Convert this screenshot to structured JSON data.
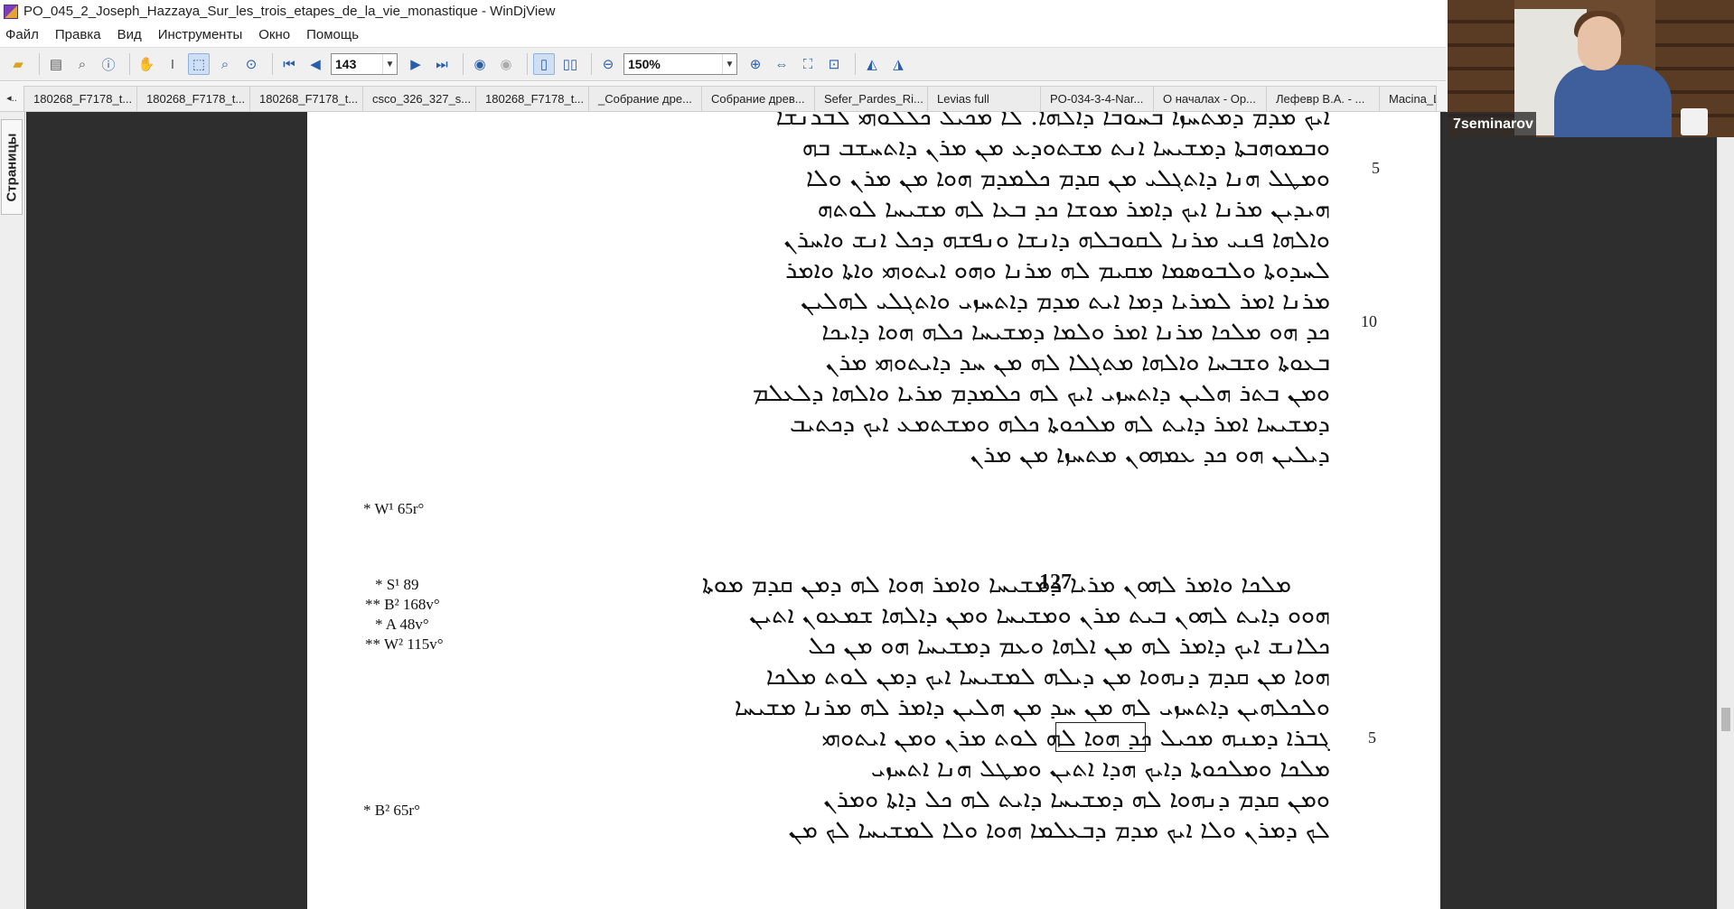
{
  "window": {
    "title": "PO_045_2_Joseph_Hazzaya_Sur_les_trois_etapes_de_la_vie_monastique - WinDjView"
  },
  "menu": [
    "Файл",
    "Правка",
    "Вид",
    "Инструменты",
    "Окно",
    "Помощь"
  ],
  "toolbar": {
    "page_number": "143",
    "zoom": "150%"
  },
  "tabs": [
    "180268_F7178_t...",
    "180268_F7178_t...",
    "180268_F7178_t...",
    "csco_326_327_s...",
    "180268_F7178_t...",
    "_Собрание дре...",
    "Собрание древ...",
    "Sefer_Pardes_Ri...",
    "Levias full",
    "PO-034-3-4-Nar...",
    "О началах - Ор...",
    "Лефевр В.А. - ...",
    "Macina_Le"
  ],
  "side_panel": {
    "pages_tab": "Страницы"
  },
  "document": {
    "lines": [
      "ܐܝܟ ܡܕܡ ܕܡܬܚܙܐ ܒܚܘܒܐ ܕܐܠܗܐ. ܠܐ ܡܟܝܠ ܟܠܠܘܗܝ ܠܒܪܢܫܐ",
      "ܘܒܡܘܗܒܬܐ ܕܡܫܝܚܐ ܐܢܬ ܡܫܬܘܕܥ ܡܢ ܡܪܢ ܕܐܬܚܫܒ ܒܗ",
      "ܘܡܛܠ ܗܢܐ ܕܐܬܓܠܝ ܡܢ ܩܕܡ ܟܠܡܕܡ ܗܘܐ ܡܢ ܡܪܢ ܘܠܐ",
      "ܗܝܕܝܢ ܡܪܢܐ ܐܝܟ ܕܐܡܪ ܡܘܫܐ ܟܕ ܒܥܐ ܠܗ ܡܫܝܚܐ ܠܘܬܗ",
      "ܘܐܠܗܐ ܦܢܝ ܡܪܢܐ ܠܩܘܒܠܗ ܕܐܢܫܐ ܘܢܦܫܗ ܕܟܠ ܐܢܫ ܘܐܚܪܢ",
      "ܠܚܕܘܬܐ ܘܠܒܘܣܡܐ ܡܩܝܡ ܠܗ ܡܪܢܐ ܘܗܘ ܐܝܬܘܗܝ ܘܐܬܐ ܘܐܡܪ",
      "ܡܪܢܐ ܐܡܪ ܠܡܪܝܐ ܕܡܐ ܐܝܬ ܡܕܡ ܕܐܬܚܙܝ ܘܐܬܓܠܝ ܠܗܠܝܢ",
      "ܟܕ ܗܘ ܡܠܟܐ ܡܪܢܐ ܐܡܪ ܘܠܡܐ ܕܡܫܝܚܐ ܟܠܗ ܗܘܐ ܕܐܝܟܐ",
      "ܒܥܘܬܐ ܘܫܒܚܐ ܘܐܠܗܐ ܡܬܓܠܐ ܠܗ ܡܢ ܚܕ ܕܐܝܬܘܗܝ ܡܪܢ",
      "ܘܡܢ ܒܬܪ ܗܠܝܢ ܕܐܬܚܙܝ ܐܝܟ ܠܗ ܟܠܡܕܡ ܡܪܝܐ ܘܐܠܗܐ ܕܠܥܠܡ",
      "ܕܡܫܝܚܐ ܐܡܪ ܕܐܝܬ ܠܗ ܡܠܟܘܬܐ ܟܠܗ ܘܡܫܬܡܥ ܐܝܟ ܕܟܬܝܒ",
      "ܕܝܠܝܢ ܗܘ ܟܕ ܥܡܗܘܢ ܡܬܚܙܐ ܡܢ ܡܪܢ",
      "ܡܠܟܐ ܘܐܡܪ ܠܗܘܢ ܡܪܝܐ ܕܡܫܝܚܐ ܘܐܡܪ ܗܘܐ ܠܗ ܕܡܢ ܩܕܡ ܡܘܬܐ",
      "ܗܘܘ ܕܐܝܬ ܠܗܘܢ ܒܝܬ ܡܪܢ ܘܡܫܝܚܐ ܘܡܢ ܕܐܠܗܐ ܫܡܥܘܢ ܐܬܝܢ",
      "ܟܠܐܢܫ ܐܝܟ ܕܐܡܪ ܠܗ ܡܢ ܐܠܗܐ ܘܥܡ ܕܡܫܝܚܐ ܗܘ ܡܢ ܟܠ",
      "ܗܘܐ ܡܢ ܩܕܡ ܕܢܗܘܐ ܡܢ ܕܝܠܗ ܠܡܫܝܚܐ ܐܝܟ ܕܡܢ ܠܘܬ ܡܠܟܐ",
      "ܘܠܟܠܗܝܢ ܕܐܬܚܙܝ ܠܗ ܡܢ ܚܕ ܡܢ ܗܠܝܢ ܕܐܡܪ ܠܗ ܡܪܢܐ ܡܫܝܚܐ",
      "ܓܒܪܐ ܕܡܢܗ ܡܟܝܠ ܟܕ ܗܘܐ ܠܗ ܠܘܬ ܡܪܢ ܘܡܢ ܐܝܬܘܗܝ",
      "ܡܠܟܐ ܘܡܠܟܘܬܐ ܕܐܝܟ ܗܕܐ ܐܬܝܢ ܘܡܛܠ ܗܢܐ ܐܬܚܙܝ",
      "ܘܡܢ ܩܕܡ ܕܢܗܘܐ ܠܗ ܕܡܫܝܚܐ ܕܐܝܬ ܠܗ ܟܠ ܕܐܬܐ ܘܡܪܢ",
      "ܠܟ ܕܡܪܢ ܘܠܐ ܐܝܟ ܡܕܡ ܕܒܥܠܡܐ ܗܘܐ ܘܠܐ ܠܡܫܝܚܐ ܠܟ ܡܢ"
    ],
    "line_numbers": [
      "5",
      "10",
      "5"
    ],
    "page_header": "127",
    "margin_notes": [
      "* W¹ 65r°",
      "* S¹ 89",
      "** B² 168v°",
      "* A 48v°",
      "** W² 115v°",
      "* B² 65r°"
    ]
  },
  "video": {
    "participant": "7seminarov"
  },
  "colors": {
    "toolbar_bg": "#f0f0f0",
    "doc_bg": "#2e2e2e",
    "page_bg": "#ffffff",
    "accent": "#2b5ea8"
  }
}
